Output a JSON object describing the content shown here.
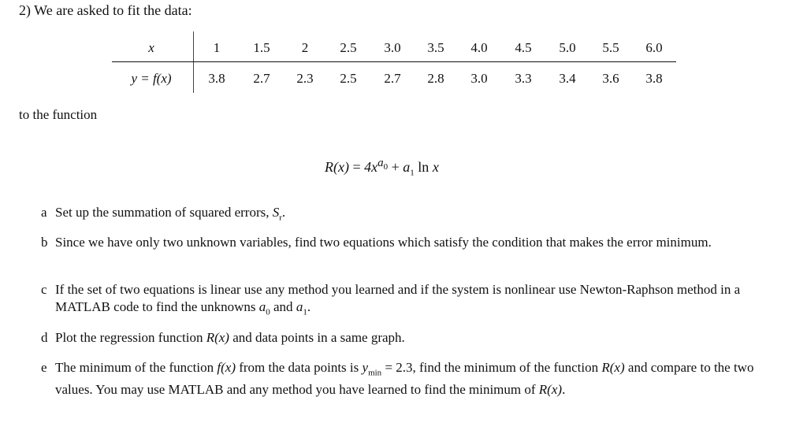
{
  "heading": "2) We are asked to fit the data:",
  "table": {
    "row_x_label": "x",
    "row_y_label": "y = f(x)",
    "x": [
      "1",
      "1.5",
      "2",
      "2.5",
      "3.0",
      "3.5",
      "4.0",
      "4.5",
      "5.0",
      "5.5",
      "6.0"
    ],
    "y": [
      "3.8",
      "2.7",
      "2.3",
      "2.5",
      "2.7",
      "2.8",
      "3.0",
      "3.3",
      "3.4",
      "3.6",
      "3.8"
    ]
  },
  "lead_text": "to the function",
  "formula": {
    "lhs": "R(x)",
    "eq": "=",
    "term1_coef": "4x",
    "term1_exp": "a",
    "term1_exp_sub": "0",
    "plus": "+",
    "term2_coef": "a",
    "term2_coef_sub": "1",
    "term2_fn": "ln",
    "term2_var": "x"
  },
  "items": [
    {
      "label": "a",
      "text": "Set up the summation of squared errors, ",
      "math": "S",
      "math_sub": "r",
      "tail": "."
    },
    {
      "label": "b",
      "text": "Since we have only two unknown variables, find two equations which satisfy the condition that makes the error minimum."
    },
    {
      "label": "c",
      "text": "If the set of two equations is linear use any method you learned and if the system is nonlinear use Newton-Raphson method in a MATLAB code to find the unknowns ",
      "math1": "a",
      "math1_sub": "0",
      "mid": " and ",
      "math2": "a",
      "math2_sub": "1",
      "tail": "."
    },
    {
      "label": "d",
      "pre": "Plot the regression function ",
      "math": "R(x)",
      "post": " and data points in a same graph."
    },
    {
      "label": "e",
      "pre": "The minimum of the function ",
      "math1": "f(x)",
      "mid1": " from the data points is ",
      "math2": "y",
      "math2_sub": "min",
      "mid2": " = 2.3, find the minimum of the function ",
      "math3": "R(x)",
      "mid3": " and compare to the two values. You may use MATLAB and any method you have learned to find the minimum of ",
      "math4": "R(x)",
      "tail": "."
    }
  ]
}
